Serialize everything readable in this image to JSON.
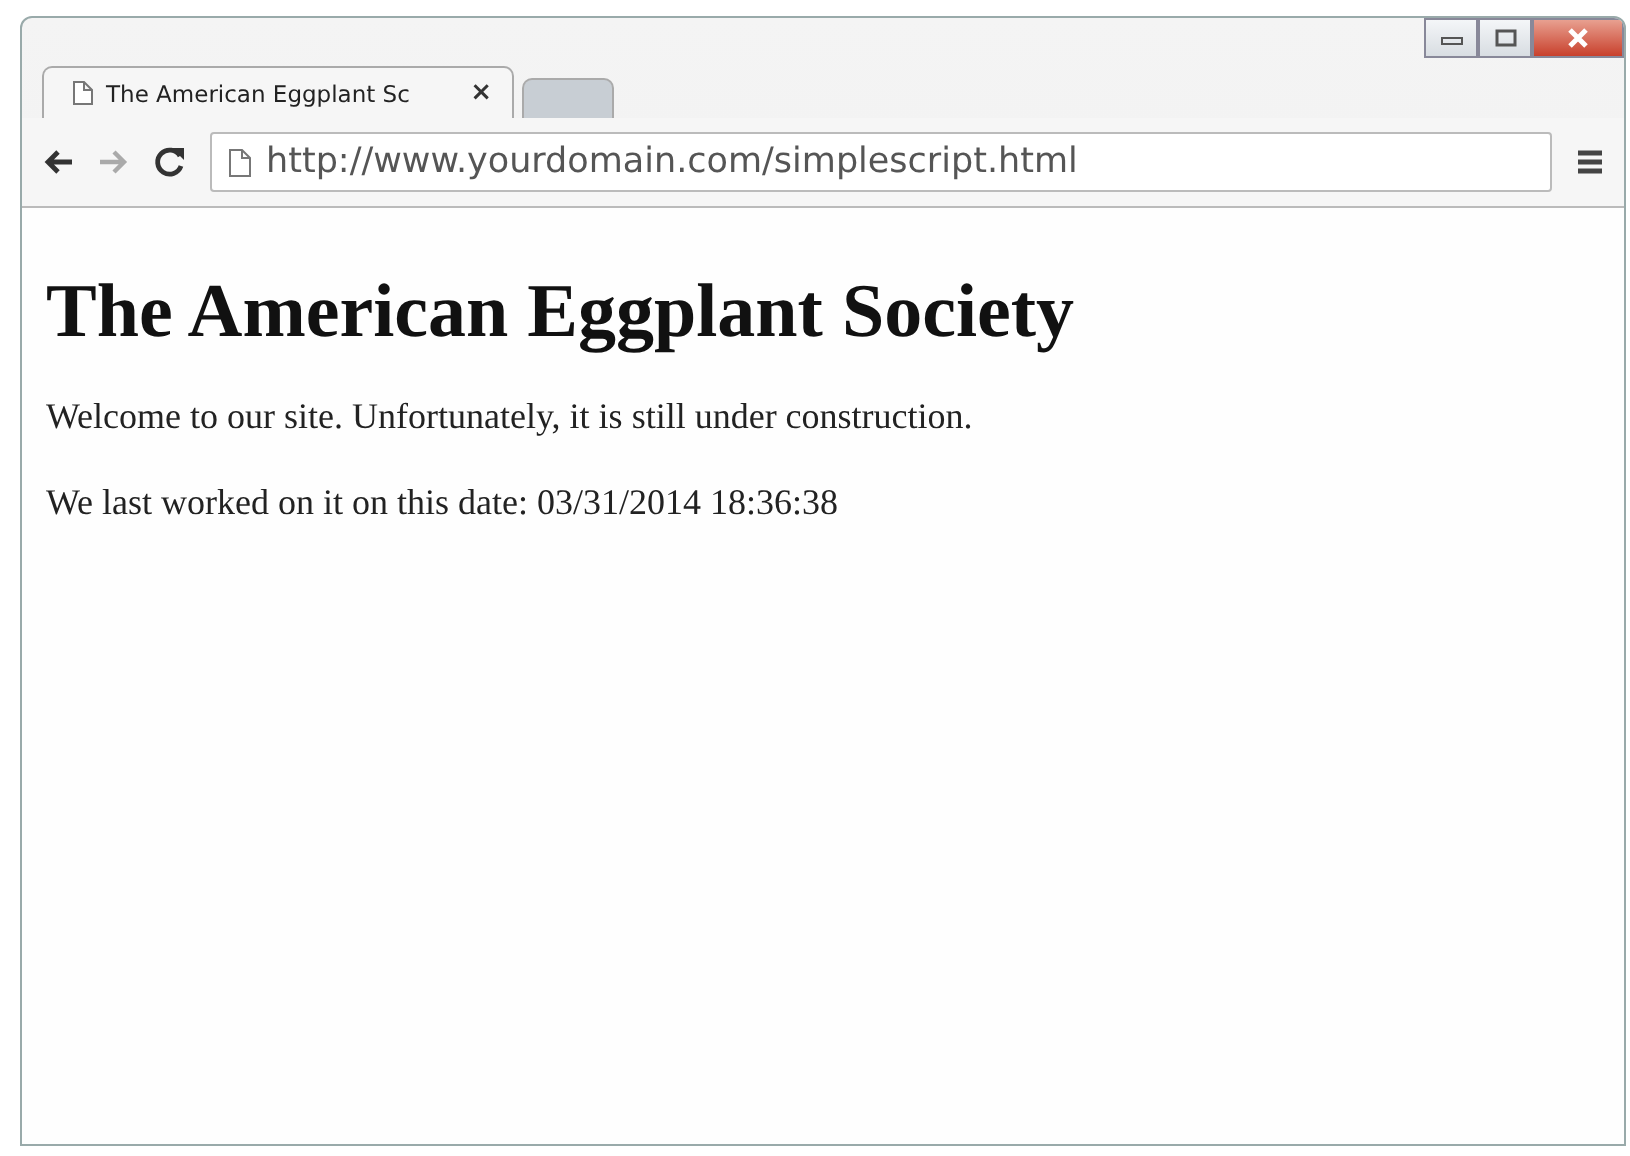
{
  "tabs": [
    {
      "title": "The American Eggplant Sc",
      "close": "×",
      "selected": true
    },
    {
      "selected": false
    }
  ],
  "address_bar": {
    "url": "http://www.yourdomain.com/simplescript.html"
  },
  "page": {
    "heading": "The American Eggplant Society",
    "paragraphs": [
      "Welcome to our site. Unfortunately, it is still under construction.",
      "We last worked on it on this date: 03/31/2014 18:36:38"
    ]
  }
}
